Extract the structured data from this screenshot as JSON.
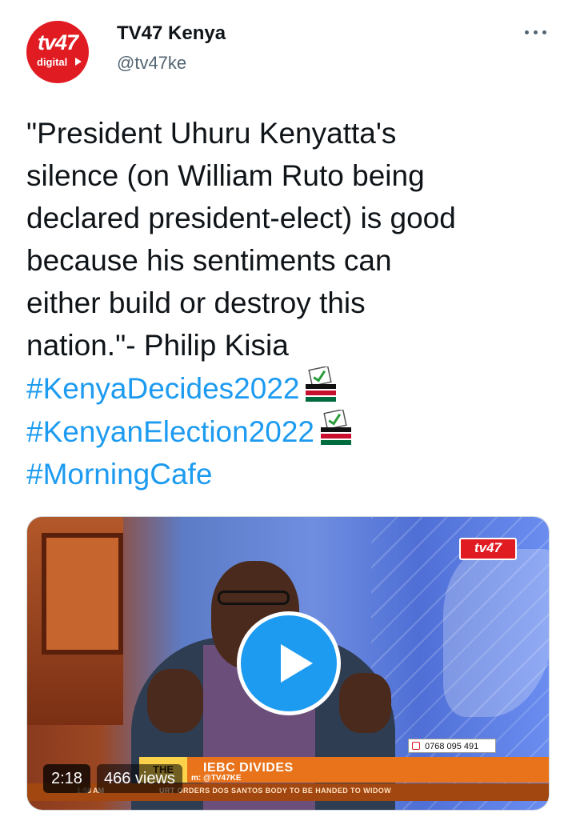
{
  "account": {
    "display_name": "TV47 Kenya",
    "handle": "@tv47ke",
    "avatar_logo_text": "tv47",
    "avatar_logo_subtext": "digital"
  },
  "tweet": {
    "text_lines": [
      "\"President Uhuru Kenyatta's",
      "silence (on William Ruto being",
      "declared president-elect) is good",
      "because his sentiments can",
      "either build or destroy this",
      "nation.\"- Philip Kisia"
    ],
    "hashtags": [
      "#KenyaDecides2022",
      "#KenyanElection2022",
      "#MorningCafe"
    ],
    "hashtag_emoji": "ballot-box-with-kenya-flag"
  },
  "video": {
    "duration": "2:18",
    "views": "466 views",
    "channel_logo": "tv47",
    "phone": "0768 095 491",
    "badge": "THE",
    "headline": "IEBC DIVIDES",
    "follow_text": "m: @TV47KE",
    "ticker": "URT ORDERS DOS SANTOS BODY TO BE HANDED TO WIDOW",
    "ticker_time": "1:58 AM"
  },
  "colors": {
    "hashtag": "#1d9bf0",
    "brand_red": "#e11b22",
    "text": "#0f1419",
    "secondary": "#536471"
  }
}
